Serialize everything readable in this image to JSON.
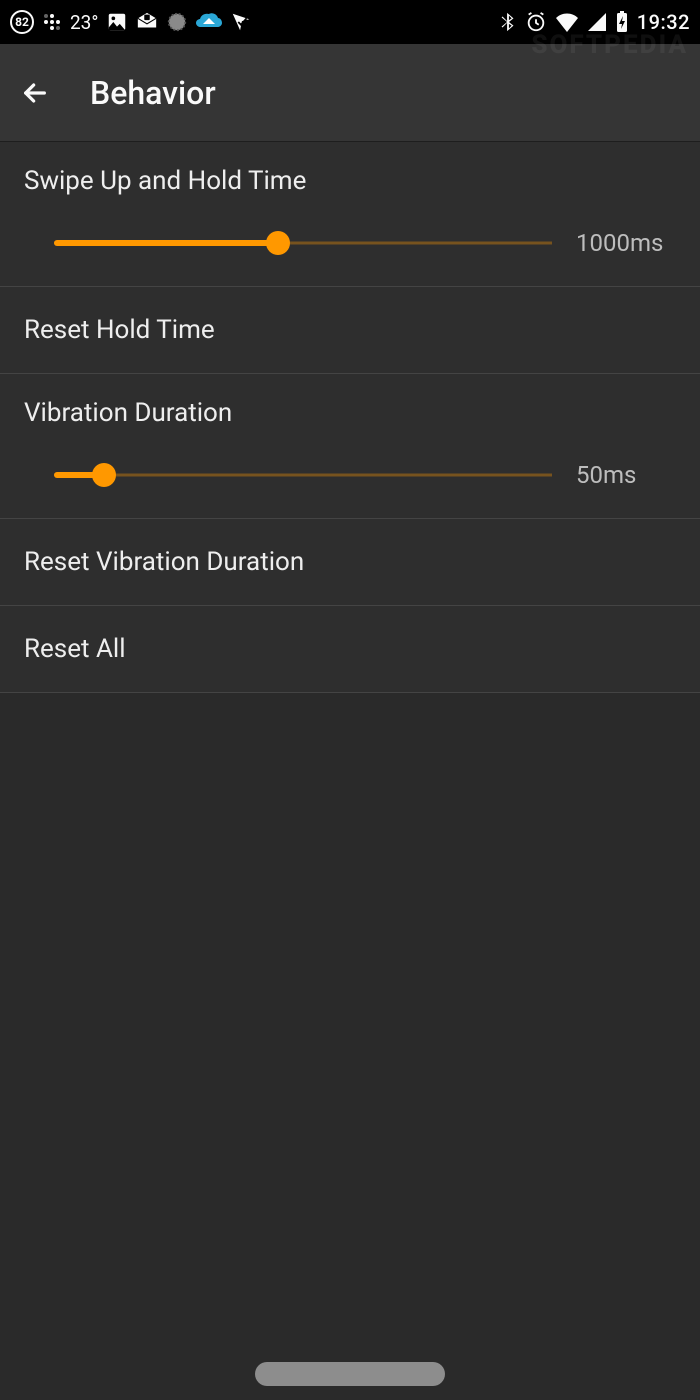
{
  "status": {
    "badge": "82",
    "temperature": "23°",
    "clock": "19:32"
  },
  "watermark": "SOFTPEDIA",
  "header": {
    "title": "Behavior"
  },
  "settings": {
    "swipe_hold": {
      "title": "Swipe Up and Hold Time",
      "value_label": "1000ms",
      "percent": 45
    },
    "reset_hold_label": "Reset Hold Time",
    "vibration": {
      "title": "Vibration Duration",
      "value_label": "50ms",
      "percent": 10
    },
    "reset_vibration_label": "Reset Vibration Duration",
    "reset_all_label": "Reset All"
  },
  "colors": {
    "accent": "#ff9800"
  }
}
